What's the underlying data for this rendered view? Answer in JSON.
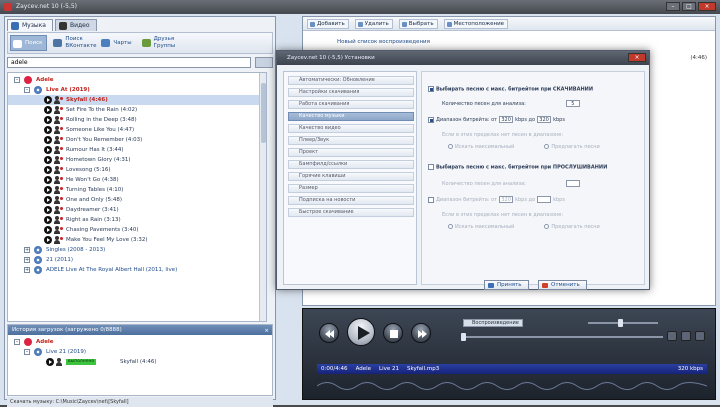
{
  "window": {
    "title": "Zaycev.net 10 (-5,5)"
  },
  "left_panel": {
    "tabs": [
      {
        "label": "Музыка",
        "icon": "music-tab-icon"
      },
      {
        "label": "Видео",
        "icon": "video-tab-icon"
      }
    ],
    "sub_buttons": [
      {
        "label": "Поиск",
        "icon": "search-people-icon"
      },
      {
        "label": "Поиск ВКонтакте",
        "icon": "vk-search-icon"
      },
      {
        "label": "Чарты",
        "icon": "charts-icon"
      },
      {
        "label": "Друзья Группы",
        "icon": "friends-icon"
      }
    ],
    "search_value": "adele",
    "tree": {
      "artist": "Adele",
      "album1": "Live At (2019)",
      "selected_track": "Skyfall (4:46)",
      "tracks": [
        "Set Fire To the Rain (4:02)",
        "Rolling in the Deep (3:48)",
        "Someone Like You (4:47)",
        "Don't You Remember (4:03)",
        "Rumour Has It (3:44)",
        "Hometown Glory (4:31)",
        "Lovesong (5:16)",
        "He Won't Go (4:38)",
        "Turning Tables (4:10)",
        "One and Only (5:48)",
        "Daydreamer (3:41)",
        "Right as Rain (3:13)",
        "Chasing Pavements (3:40)",
        "Make You Feel My Love (3:32)"
      ],
      "albums_more": [
        "Singles (2008 - 2013)",
        "21 (2011)",
        "ADELE Live At The Royal Albert Hall (2011, live)"
      ]
    },
    "history": {
      "header": "История загрузок (загружено 0/8888)",
      "artist": "Adele",
      "album": "Live 21 (2019)",
      "progress_label": "выполнено",
      "track": "Skyfall (4:46)"
    },
    "status": "Скачать музыку: C:\\Music\\Zaycev\\net\\[Skyfall]"
  },
  "right_panel": {
    "toolbar": [
      "Добавить",
      "Удалить",
      "Выбрать",
      "Местоположение"
    ],
    "new_list_label": "Новый список воспроизведения",
    "counter": "(4:46)"
  },
  "dialog": {
    "title": "Zaycev.net 10 (-5,5)    Установки",
    "nav": [
      "Автоматически: Обновление",
      "Настройки скачивания",
      "Работа скачивания",
      "Качество музыки",
      "Качество видео",
      "Плеер/Звук",
      "Проект",
      "Бампфилд/ссылки",
      "Горячие клавиши",
      "Размер",
      "Подписка на новости",
      "Быстрое скачивание"
    ],
    "active_nav": 3,
    "sec1_title": "Выбирать песню с макс. битрейтом при СКАЧИВАНИИ",
    "sec1_count_label": "Количество песен для анализа:",
    "sec1_count": "5",
    "sec1_range_label": "Диапазон битрейта: от",
    "sec1_from": "320",
    "sec1_to_label": "kbps до",
    "sec1_to": "320",
    "sec1_unit": "kbps",
    "sec1_missing_label": "Если в этих пределах нет песен в диапазоне:",
    "sec1_opt_a": "Искать максимальный",
    "sec1_opt_b": "Предлагать песни",
    "sec2_title": "Выбирать песню с макс. битрейтом при ПРОСЛУШИВАНИИ",
    "sec2_count_label": "Количество песен для анализа:",
    "sec2_range_label": "Диапазон битрейта: от",
    "sec2_from": "320",
    "sec2_to_label": "kbps до",
    "sec2_unit": "kbps",
    "sec2_missing_label": "Если в этих пределах нет песен в диапазоне:",
    "sec2_opt_a": "Искать максимальный",
    "sec2_opt_b": "Предлагать песни",
    "apply": "Принять",
    "cancel": "Отменить"
  },
  "player": {
    "mode": "Воспроизведение",
    "time": "0:00/4:46",
    "artist": "Adele",
    "album": "Live 21",
    "file": "Skyfall.mp3",
    "bitrate": "320 kbps"
  }
}
